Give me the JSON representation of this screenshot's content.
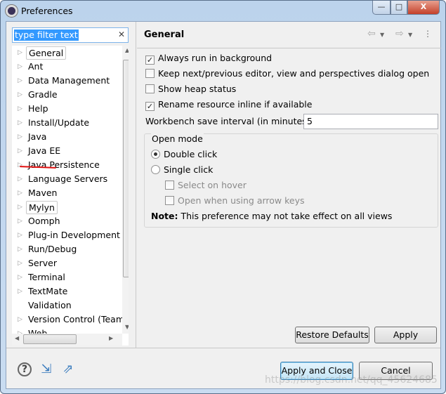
{
  "window": {
    "title": "Preferences",
    "min": "—",
    "max": "□",
    "close": "X"
  },
  "filter": {
    "value": "type filter text",
    "clear": "✕"
  },
  "tree": {
    "items": [
      {
        "label": "General",
        "arrow": true,
        "boxed": true
      },
      {
        "label": "Ant",
        "arrow": true
      },
      {
        "label": "Data Management",
        "arrow": true
      },
      {
        "label": "Gradle",
        "arrow": true
      },
      {
        "label": "Help",
        "arrow": true
      },
      {
        "label": "Install/Update",
        "arrow": true
      },
      {
        "label": "Java",
        "arrow": true,
        "underlined": true
      },
      {
        "label": "Java EE",
        "arrow": true
      },
      {
        "label": "Java Persistence",
        "arrow": true
      },
      {
        "label": "Language Servers",
        "arrow": true
      },
      {
        "label": "Maven",
        "arrow": true
      },
      {
        "label": "Mylyn",
        "arrow": true,
        "boxed": true
      },
      {
        "label": "Oomph",
        "arrow": true
      },
      {
        "label": "Plug-in Development",
        "arrow": true
      },
      {
        "label": "Run/Debug",
        "arrow": true
      },
      {
        "label": "Server",
        "arrow": true
      },
      {
        "label": "Terminal",
        "arrow": true
      },
      {
        "label": "TextMate",
        "arrow": true
      },
      {
        "label": "Validation",
        "arrow": false
      },
      {
        "label": "Version Control (Team)",
        "arrow": true
      },
      {
        "label": "Web",
        "arrow": true
      }
    ]
  },
  "page": {
    "title": "General",
    "options": [
      {
        "label": "Always run in background",
        "checked": true
      },
      {
        "label": "Keep next/previous editor, view and perspectives dialog open",
        "checked": false
      },
      {
        "label": "Show heap status",
        "checked": false
      },
      {
        "label": "Rename resource inline if available",
        "checked": true
      }
    ],
    "interval_label": "Workbench save interval (in minutes):",
    "interval_value": "5",
    "open_mode": {
      "label": "Open mode",
      "double": "Double click",
      "single": "Single click",
      "select_hover": "Select on hover",
      "open_arrow": "Open when using arrow keys",
      "note_bold": "Note:",
      "note": " This preference may not take effect on all views"
    },
    "restore": "Restore Defaults",
    "apply": "Apply"
  },
  "footer": {
    "apply_close": "Apply and Close",
    "cancel": "Cancel"
  },
  "watermark": "https://blog.csdn.net/qq_45624685"
}
